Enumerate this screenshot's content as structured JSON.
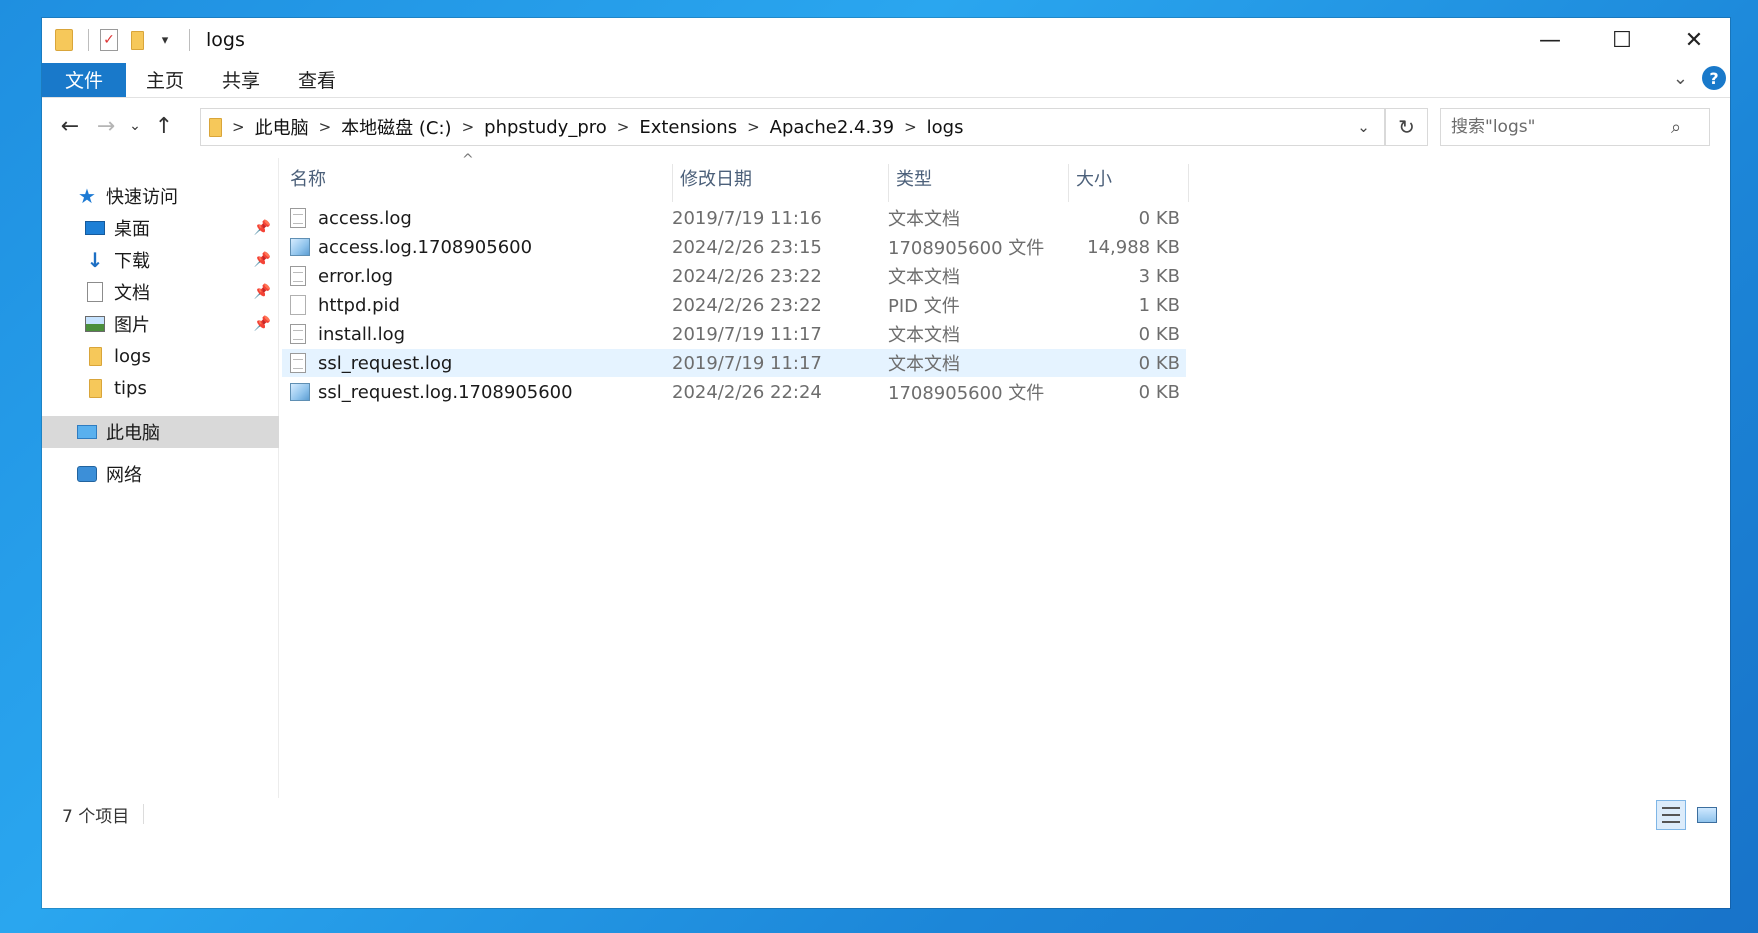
{
  "window": {
    "title": "logs",
    "controls": {
      "minimize": "—",
      "maximize": "☐",
      "close": "✕"
    }
  },
  "ribbon": {
    "tabs": [
      "文件",
      "主页",
      "共享",
      "查看"
    ]
  },
  "nav": {
    "back": "←",
    "forward": "→",
    "recent": "⌄",
    "up": "↑"
  },
  "address": {
    "crumbs": [
      "此电脑",
      "本地磁盘 (C:)",
      "phpstudy_pro",
      "Extensions",
      "Apache2.4.39",
      "logs"
    ],
    "separator": ">",
    "refresh": "↻"
  },
  "search": {
    "placeholder": "搜索\"logs\""
  },
  "sidebar": {
    "items": [
      {
        "label": "快速访问",
        "icon": "star-icon",
        "pinned": false
      },
      {
        "label": "桌面",
        "icon": "desktop-icon",
        "pinned": true
      },
      {
        "label": "下载",
        "icon": "download-icon",
        "pinned": true
      },
      {
        "label": "文档",
        "icon": "document-icon",
        "pinned": true
      },
      {
        "label": "图片",
        "icon": "pictures-icon",
        "pinned": true
      },
      {
        "label": "logs",
        "icon": "folder-icon",
        "pinned": false
      },
      {
        "label": "tips",
        "icon": "folder-icon",
        "pinned": false
      },
      {
        "label": "此电脑",
        "icon": "computer-icon",
        "pinned": false
      },
      {
        "label": "网络",
        "icon": "network-icon",
        "pinned": false
      }
    ]
  },
  "files": {
    "columns": [
      "名称",
      "修改日期",
      "类型",
      "大小"
    ],
    "rows": [
      {
        "name": "access.log",
        "date": "2019/7/19 11:16",
        "type": "文本文档",
        "size": "0 KB",
        "icon": "text-file-icon"
      },
      {
        "name": "access.log.1708905600",
        "date": "2024/2/26 23:15",
        "type": "1708905600 文件",
        "size": "14,988 KB",
        "icon": "generic-file-icon"
      },
      {
        "name": "error.log",
        "date": "2024/2/26 23:22",
        "type": "文本文档",
        "size": "3 KB",
        "icon": "text-file-icon"
      },
      {
        "name": "httpd.pid",
        "date": "2024/2/26 23:22",
        "type": "PID 文件",
        "size": "1 KB",
        "icon": "blank-file-icon"
      },
      {
        "name": "install.log",
        "date": "2019/7/19 11:17",
        "type": "文本文档",
        "size": "0 KB",
        "icon": "text-file-icon"
      },
      {
        "name": "ssl_request.log",
        "date": "2019/7/19 11:17",
        "type": "文本文档",
        "size": "0 KB",
        "icon": "text-file-icon"
      },
      {
        "name": "ssl_request.log.1708905600",
        "date": "2024/2/26 22:24",
        "type": "1708905600 文件",
        "size": "0 KB",
        "icon": "generic-file-icon"
      }
    ],
    "selected_index": 5
  },
  "status": {
    "item_count": "7 个项目"
  },
  "colors": {
    "accent": "#1979ca",
    "selection": "#e5f3ff",
    "nav_selected": "#d9d9d9"
  }
}
